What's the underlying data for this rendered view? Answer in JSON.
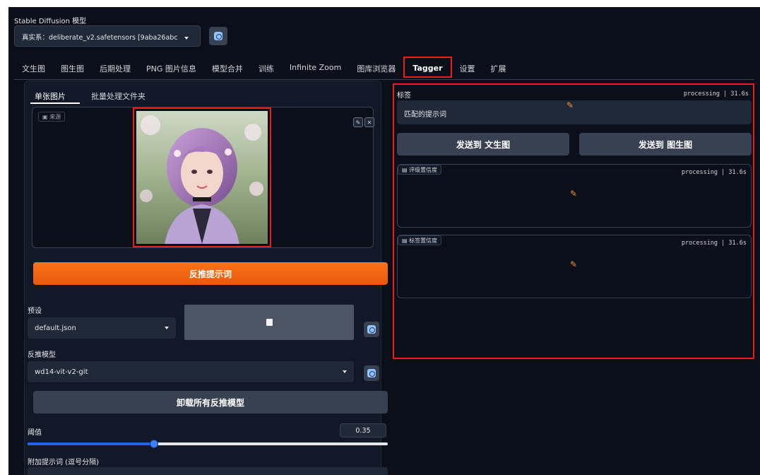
{
  "model": {
    "label": "Stable Diffusion 模型",
    "selected": "真实系：deliberate_v2.safetensors [9aba26abc"
  },
  "tabs": [
    {
      "label": "文生图"
    },
    {
      "label": "图生图"
    },
    {
      "label": "后期处理"
    },
    {
      "label": "PNG 图片信息"
    },
    {
      "label": "模型合并"
    },
    {
      "label": "训练"
    },
    {
      "label": "Infinite Zoom"
    },
    {
      "label": "图库浏览器"
    },
    {
      "label": "Tagger",
      "active": true
    },
    {
      "label": "设置"
    },
    {
      "label": "扩展"
    }
  ],
  "left": {
    "subtabs": [
      {
        "label": "单张图片",
        "active": true
      },
      {
        "label": "批量处理文件夹"
      }
    ],
    "image": {
      "source_label": "来源",
      "edit_icon": "pencil-icon",
      "close_icon": "close-icon"
    },
    "interrogate_button": "反推提示词",
    "preset": {
      "label": "预设",
      "value": "default.json"
    },
    "save_icon": "save-icon",
    "model": {
      "label": "反推模型",
      "value": "wd14-vit-v2-git"
    },
    "unload_button": "卸载所有反推模型",
    "threshold": {
      "label": "阈值",
      "value": "0.35",
      "fraction": 0.35
    },
    "extra_tags_label": "附加提示词 (逗号分隔)"
  },
  "right": {
    "tags": {
      "label": "标签",
      "status": "processing | 31.6s",
      "value": "匹配的提示词"
    },
    "send_txt2img": "发送到 文生图",
    "send_img2img": "发送到 图生图",
    "rating": {
      "label": "评级置信度",
      "status": "processing | 31.6s"
    },
    "tag_conf": {
      "label": "标签置信度",
      "status": "processing | 31.6s"
    }
  },
  "colors": {
    "background": "#0b0f19",
    "accent_orange": "#f97316",
    "highlight_red": "#ef1c1c",
    "slider_blue": "#2563eb"
  }
}
